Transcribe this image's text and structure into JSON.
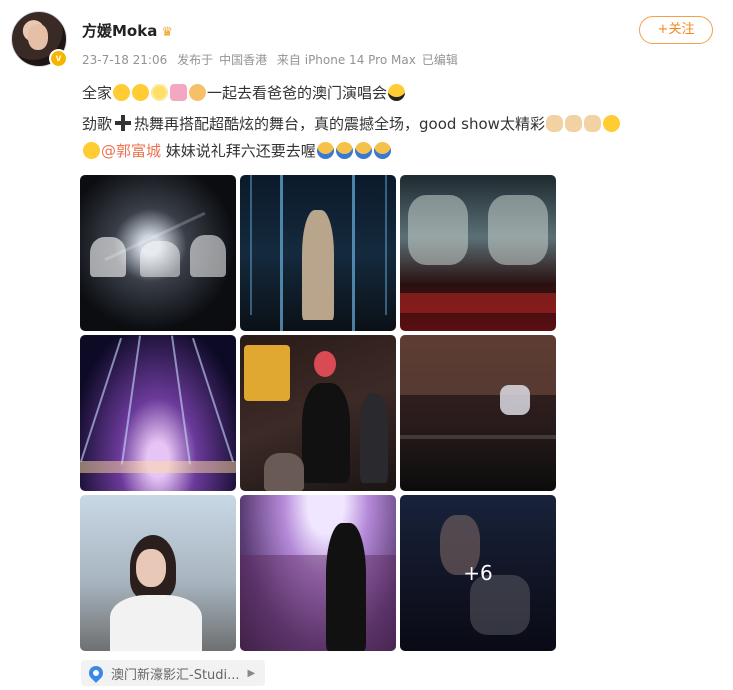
{
  "post": {
    "author": "方媛Moka",
    "time": "23-7-18 21:06",
    "source_prefix": "发布于",
    "region": "中国香港",
    "device": "来自 iPhone 14 Pro Max",
    "edited": "已编辑",
    "follow_label": "+关注",
    "line1_a": "全家",
    "line1_b": "一起去看爸爸的澳门演唱会",
    "line2_a": "劲歌",
    "line2_b": "热舞再搭配超酷炫的舞台，真的震撼全场，good show太精彩",
    "mention": "@郭富城",
    "line3_b": "妹妹说礼拜六还要去喔",
    "more_count": "+6",
    "location": "澳门新濠影汇-Studi..."
  },
  "icons": {
    "verified": "verified-badge-icon",
    "crown": "crown-icon",
    "location": "location-pin-icon",
    "chevron": "chevron-right-icon"
  },
  "colors": {
    "accent": "#f08a24",
    "mention": "#eb7350",
    "meta_text": "#939393",
    "location_pin": "#3a89e8"
  }
}
